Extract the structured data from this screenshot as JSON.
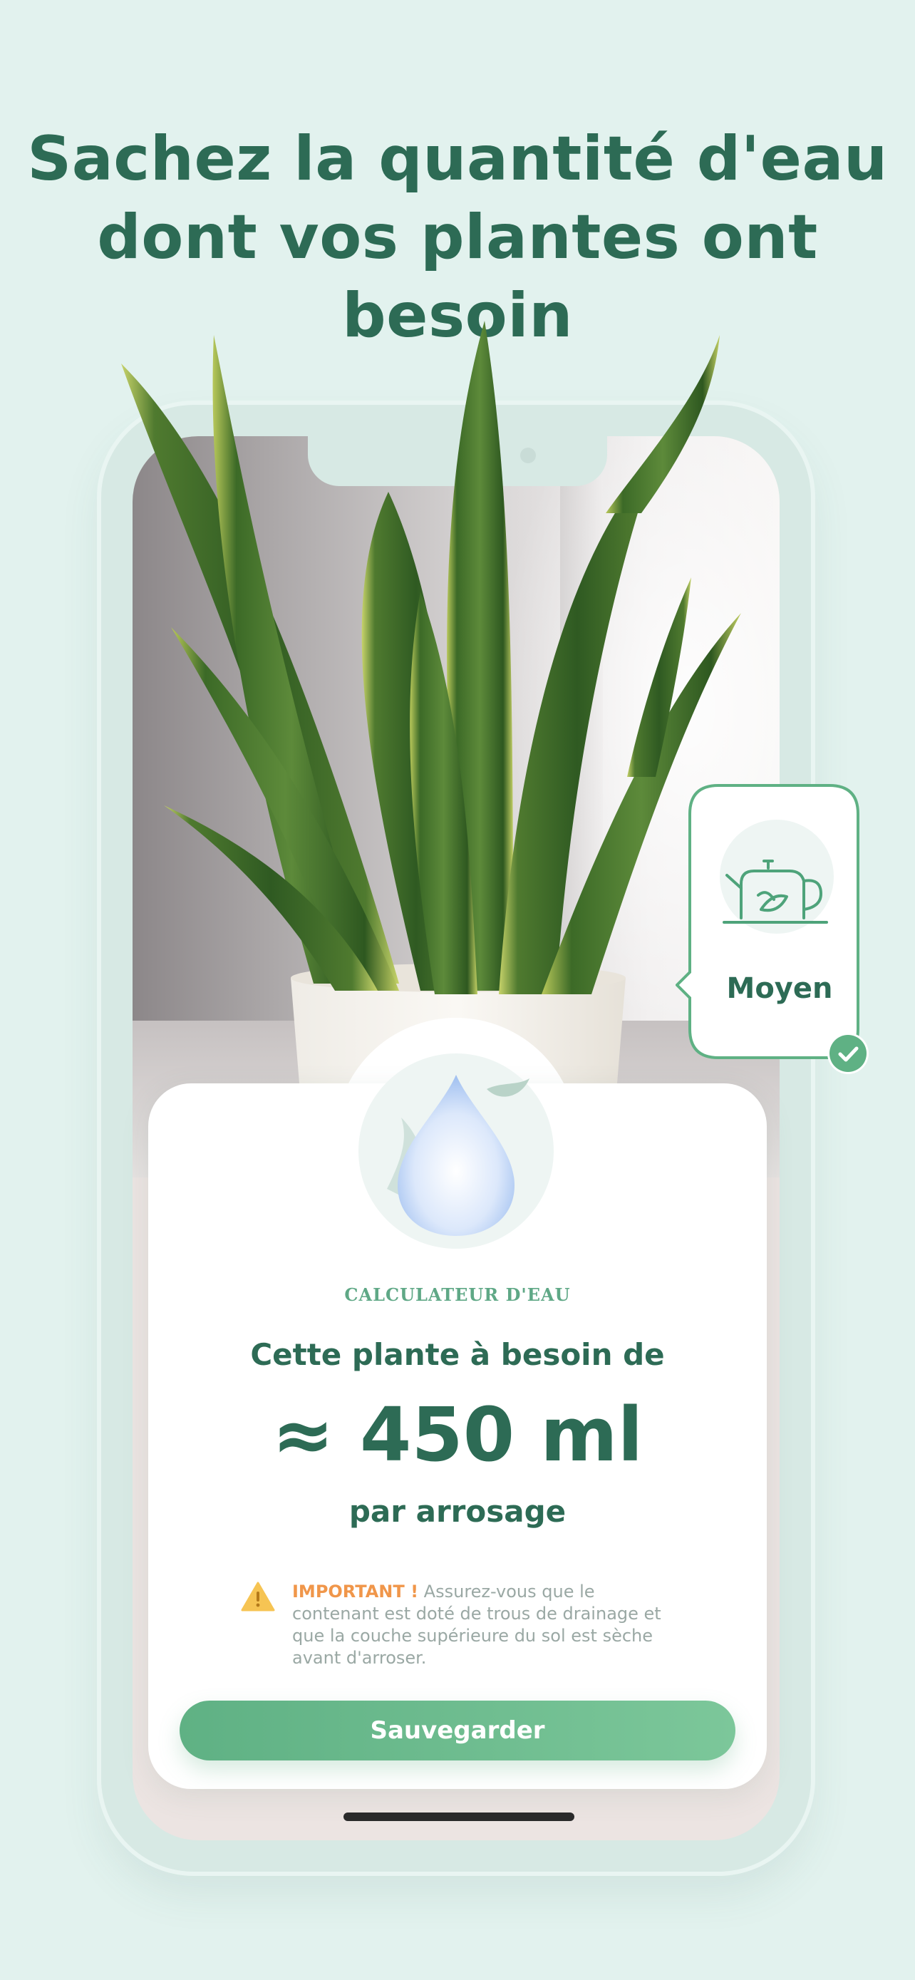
{
  "headline": {
    "line1": "Sachez la quantité d'eau",
    "line2": "dont vos plantes ont besoin"
  },
  "watering_level": {
    "label": "Moyen",
    "selected": true
  },
  "card": {
    "kicker": "CALCULATEUR D'EAU",
    "line1": "Cette plante à besoin de",
    "amount": "≈ 450 ml",
    "line3": "par arrosage",
    "warning_label": "IMPORTANT !",
    "warning_text": " Assurez-vous que le contenant est doté de trous de drainage et que la couche supérieure du sol est sèche avant d'arroser.",
    "save_label": "Sauvegarder"
  },
  "icons": [
    "kettle-icon",
    "check-icon",
    "warning-icon",
    "water-drop-icon"
  ],
  "colors": {
    "background": "#e2f2ee",
    "primary": "#2d6b55",
    "accent": "#5fb184",
    "warning": "#f0964a"
  }
}
